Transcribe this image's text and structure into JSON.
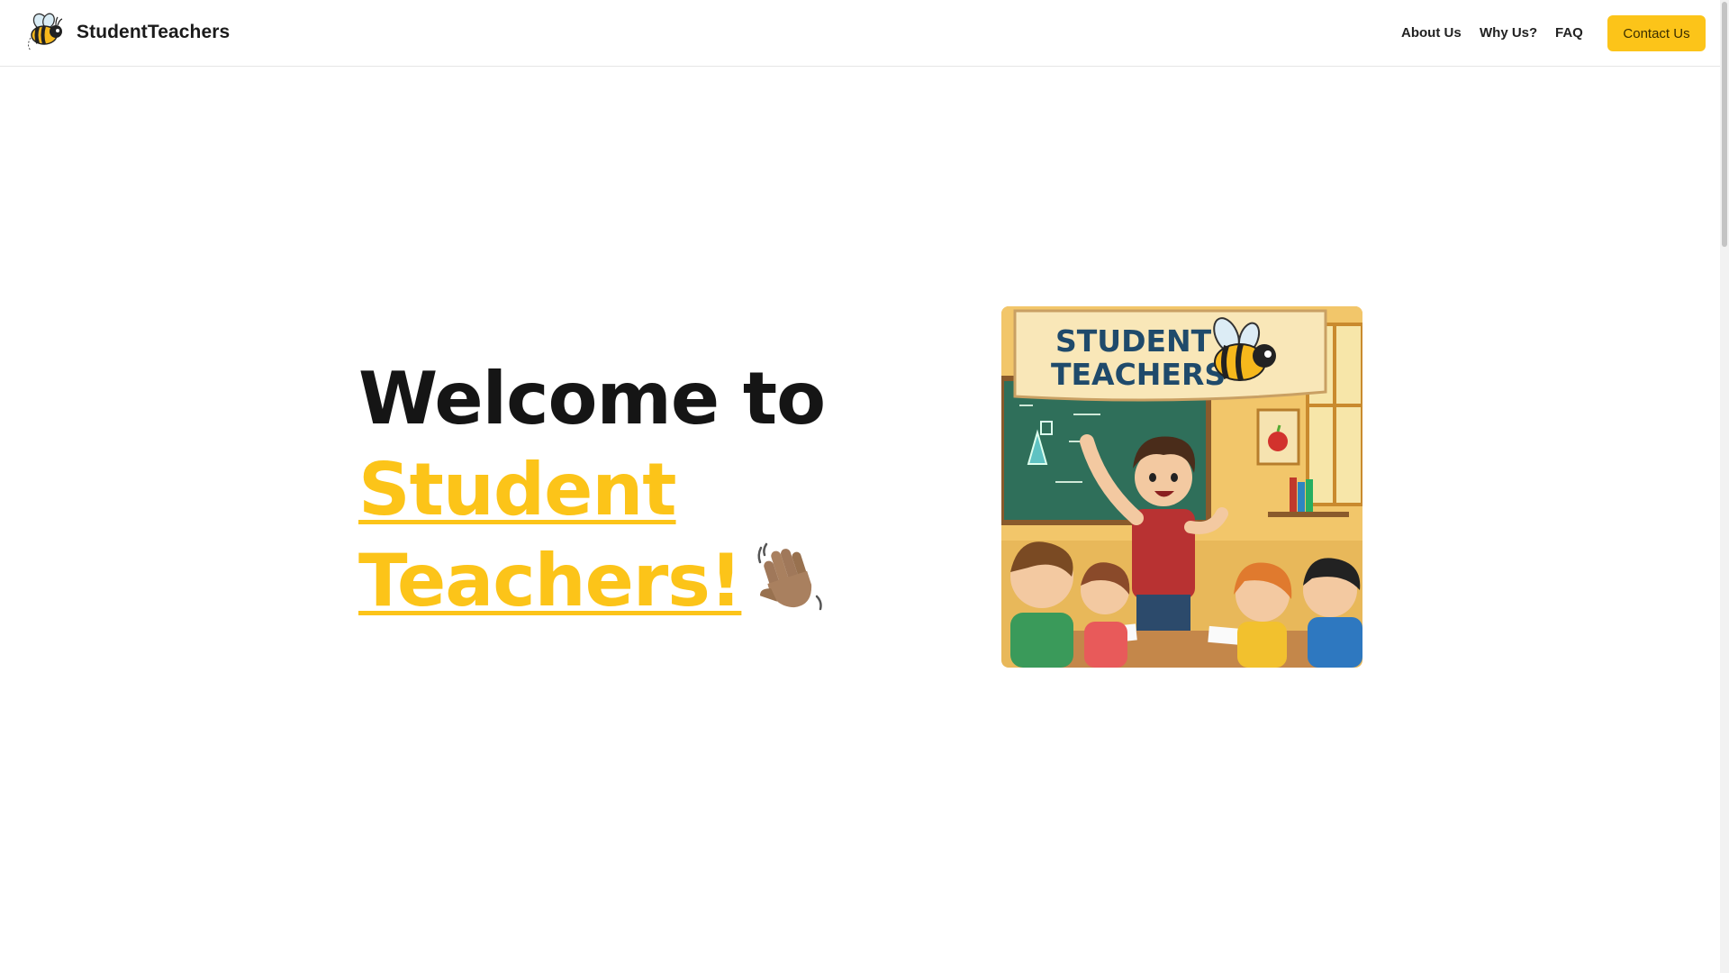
{
  "header": {
    "brand_name": "StudentTeachers",
    "logo_icon": "bee-logo-icon",
    "nav": {
      "about": "About Us",
      "why": "Why Us?",
      "faq": "FAQ"
    },
    "contact_label": "Contact Us"
  },
  "hero": {
    "title_line1": "Welcome to",
    "title_line2": "Student",
    "title_line3": "Teachers!",
    "wave_icon": "waving-hand-icon",
    "illustration": {
      "banner_line1": "STUDENT",
      "banner_line2": "TEACHERS"
    }
  },
  "colors": {
    "accent": "#fcc419",
    "text": "#151515"
  }
}
